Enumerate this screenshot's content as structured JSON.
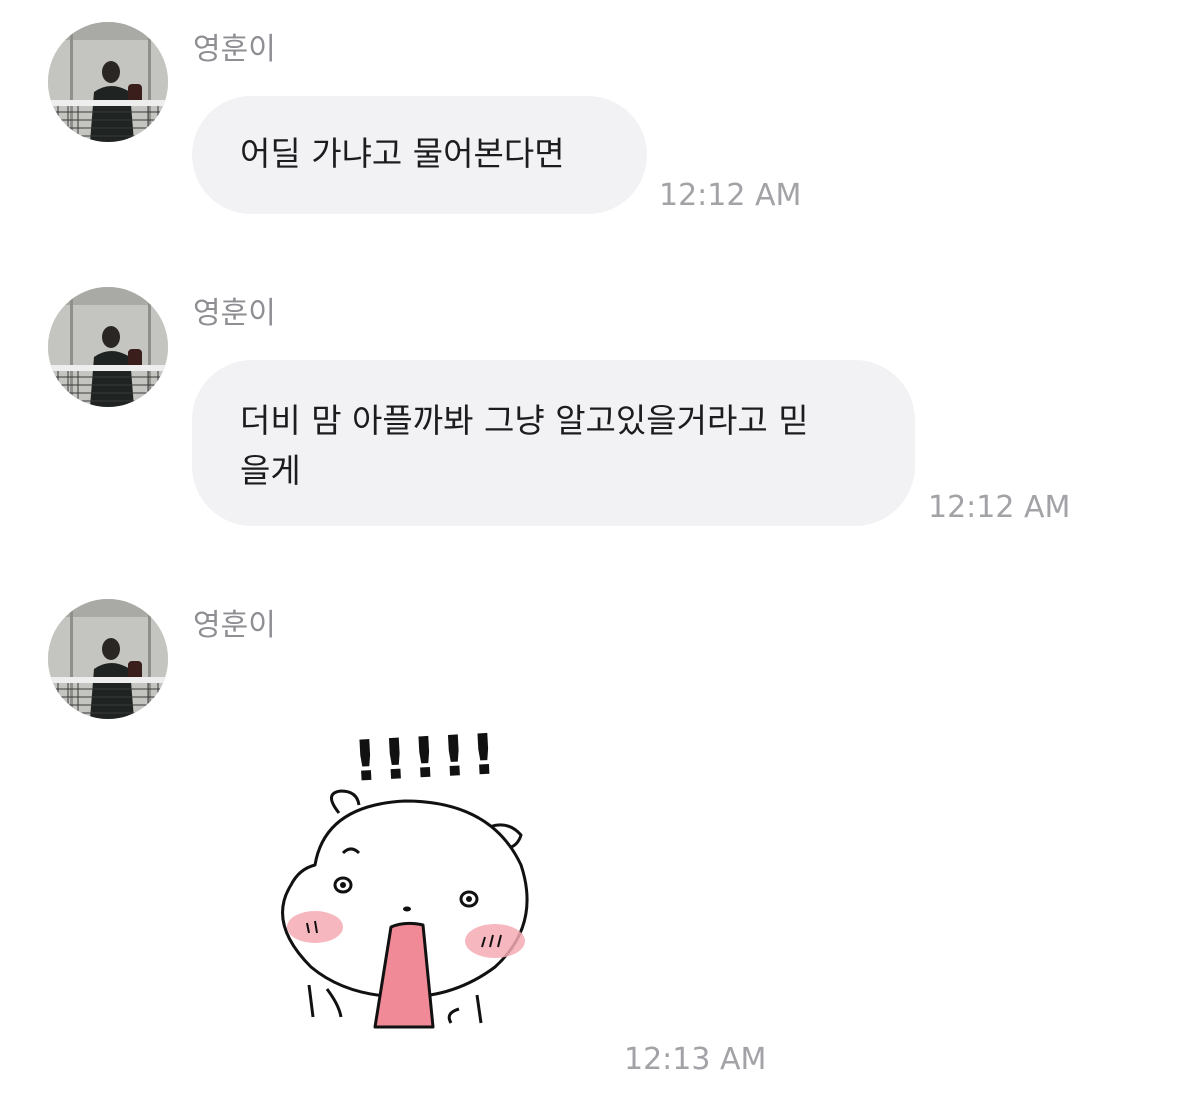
{
  "messages": [
    {
      "sender": "영훈이",
      "text": "어딜 가냐고 물어본다면",
      "time": "12:12 AM"
    },
    {
      "sender": "영훈이",
      "text": "더비 맘 아플까봐 그냥 알고있을거라고 믿\n을게",
      "time": "12:12 AM"
    },
    {
      "sender": "영훈이",
      "sticker": {
        "name": "surprised-bear-sticker",
        "text": "!!!!!"
      },
      "time": "12:13 AM"
    }
  ],
  "colors": {
    "bubble": "#f2f2f5",
    "sender": "#8e8e93",
    "time": "#a2a2a7",
    "blush": "#f6aab4",
    "tongue": "#f08a97"
  }
}
